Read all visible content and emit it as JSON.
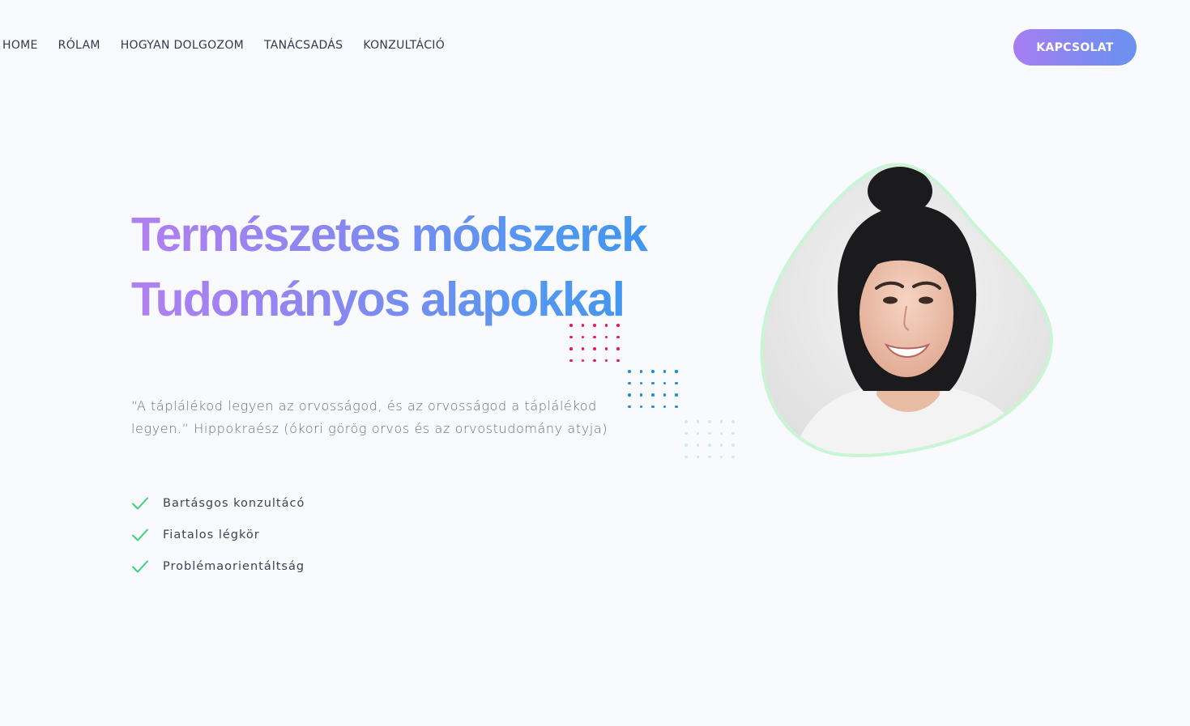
{
  "nav": {
    "items": [
      {
        "label": "HOME"
      },
      {
        "label": "RÓLAM"
      },
      {
        "label": "HOGYAN DOLGOZOM"
      },
      {
        "label": "TANÁCSADÁS"
      },
      {
        "label": "KONZULTÁCIÓ"
      }
    ],
    "cta_label": "KAPCSOLAT"
  },
  "hero": {
    "title_line1": "Természetes módszerek",
    "title_line2": "Tudományos alapokkal",
    "quote_line1": "“A táplálékod legyen az orvosságod, és az orvosságod a táplálékod",
    "quote_line2": "legyen.” Hippokraész (ókori görög orvos és az orvostudomány atyja)"
  },
  "features": [
    {
      "label": "Bartásgos konzultácó",
      "icon": "check-icon"
    },
    {
      "label": "Fiatalos légkör",
      "icon": "check-icon"
    },
    {
      "label": "Problémaorientáltság",
      "icon": "check-icon"
    }
  ],
  "portrait": {
    "subject": "smiling woman with dark hair in a bun",
    "frame_color": "#c8f5d4"
  },
  "colors": {
    "accent_purple": "#a77ef2",
    "accent_blue": "#2e95ee",
    "check_green": "#3ed07a",
    "dots_pink": "#e8195e",
    "dots_blue": "#1a8fd8",
    "dots_green": "#c9efd8",
    "background": "#f9fafe"
  }
}
